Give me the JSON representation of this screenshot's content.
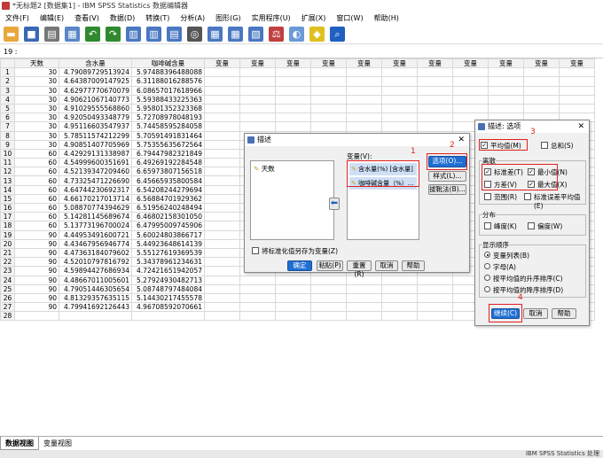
{
  "window_title": "*无标题2 [数据集1] - IBM SPSS Statistics 数据编辑器",
  "menu": [
    "文件(F)",
    "编辑(E)",
    "查看(V)",
    "数据(D)",
    "转换(T)",
    "分析(A)",
    "图形(G)",
    "实用程序(U)",
    "扩展(X)",
    "窗口(W)",
    "帮助(H)"
  ],
  "cell_ref": "19 :",
  "columns": [
    "天数",
    "含水量",
    "咖啡碱含量",
    "变量",
    "变量",
    "变量",
    "变量",
    "变量",
    "变量",
    "变量",
    "变量",
    "变量",
    "变量",
    "变量"
  ],
  "rows": [
    [
      "1",
      "30",
      "4.79089729513924",
      "5.97488396488088"
    ],
    [
      "2",
      "30",
      "4.64387009147925",
      "6.31188016288576"
    ],
    [
      "3",
      "30",
      "4.62977770670079",
      "6.08657017618966"
    ],
    [
      "4",
      "30",
      "4.90621067140773",
      "5.59388433225363"
    ],
    [
      "5",
      "30",
      "4.91029555568860",
      "5.95801352323368"
    ],
    [
      "6",
      "30",
      "4.92050493348779",
      "5.72708978048193"
    ],
    [
      "7",
      "30",
      "4.95116603547937",
      "5.74458595284058"
    ],
    [
      "8",
      "30",
      "5.78511574212299",
      "5.70591491831464"
    ],
    [
      "9",
      "30",
      "4.90851407705969",
      "5.75355635672564"
    ],
    [
      "10",
      "60",
      "4.42929131338987",
      "6.79447982321849"
    ],
    [
      "11",
      "60",
      "4.54999600351691",
      "6.49269192284548"
    ],
    [
      "12",
      "60",
      "4.52139347209460",
      "6.65973807156518"
    ],
    [
      "13",
      "60",
      "4.73325471226690",
      "6.45665935800584"
    ],
    [
      "14",
      "60",
      "4.64744230692317",
      "6.54208244279694"
    ],
    [
      "15",
      "60",
      "4.66170217013714",
      "6.56884701929362"
    ],
    [
      "16",
      "60",
      "5.08870774394629",
      "6.51956240248494"
    ],
    [
      "17",
      "60",
      "5.14281145689674",
      "6.46802158301050"
    ],
    [
      "18",
      "60",
      "5.13773196700024",
      "6.47995009745906"
    ],
    [
      "19",
      "90",
      "4.44953491600721",
      "5.60024803866717"
    ],
    [
      "20",
      "90",
      "4.43467956946774",
      "5.44923648614139"
    ],
    [
      "21",
      "90",
      "4.47363184079602",
      "5.55127619369539"
    ],
    [
      "22",
      "90",
      "4.52010797816792",
      "5.34378961234631"
    ],
    [
      "23",
      "90",
      "4.59894427686934",
      "4.72421651942057"
    ],
    [
      "24",
      "90",
      "4.48667011005601",
      "5.27924930482713"
    ],
    [
      "25",
      "90",
      "4.79051446305654",
      "5.08748797484084"
    ],
    [
      "26",
      "90",
      "4.81329357635115",
      "5.14430217455578"
    ],
    [
      "27",
      "90",
      "4.79941692126443",
      "4.96708592070661"
    ],
    [
      "28",
      "",
      "",
      ""
    ]
  ],
  "tabs": {
    "data_view": "数据视图",
    "variable_view": "变量视图"
  },
  "status": "IBM SPSS Statistics 处理",
  "desc_dialog": {
    "title": "描述",
    "source_var": "天数",
    "var_label": "变量(V):",
    "vars": [
      "含水量(%) [含水量]",
      "咖啡碱含量（%）..."
    ],
    "options_btn": "选项(O)...",
    "style_btn": "样式(L)...",
    "bootstrap_btn": "拔靴法(B)...",
    "save_std": "将标准化值另存为变量(Z)",
    "ok": "确定",
    "paste": "粘贴(P)",
    "reset": "重置(R)",
    "cancel": "取消",
    "help": "帮助"
  },
  "opt_dialog": {
    "title": "描述: 选项",
    "mean": "平均值(M)",
    "sum": "总和(S)",
    "dispersion": "离散",
    "std": "标准差(T)",
    "min": "最小值(N)",
    "var": "方差(V)",
    "max": "最大值(X)",
    "range": "范围(R)",
    "se_mean": "标准误差平均值(E)",
    "distribution": "分布",
    "kurtosis": "峰度(K)",
    "skewness": "偏度(W)",
    "display_order": "显示顺序",
    "order_var_list": "变量列表(B)",
    "order_alpha": "字母(A)",
    "order_asc": "按平均值的升序排序(C)",
    "order_desc": "按平均值的降序排序(D)",
    "continue": "继续(C)",
    "cancel": "取消",
    "help": "帮助"
  },
  "annotations": [
    "1",
    "2",
    "3",
    "4"
  ]
}
